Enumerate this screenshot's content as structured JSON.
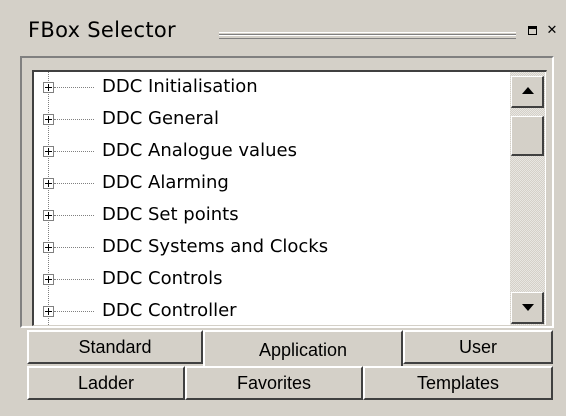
{
  "window": {
    "title": "FBox Selector"
  },
  "tree": {
    "items": [
      {
        "label": "DDC Initialisation"
      },
      {
        "label": "DDC General"
      },
      {
        "label": "DDC Analogue values"
      },
      {
        "label": "DDC Alarming"
      },
      {
        "label": "DDC Set points"
      },
      {
        "label": "DDC Systems and Clocks"
      },
      {
        "label": "DDC Controls"
      },
      {
        "label": "DDC Controller"
      }
    ]
  },
  "tabs": {
    "row1": [
      {
        "label": "Standard",
        "active": false
      },
      {
        "label": "Application",
        "active": true
      },
      {
        "label": "User",
        "active": false
      }
    ],
    "row2": [
      {
        "label": "Ladder",
        "active": false
      },
      {
        "label": "Favorites",
        "active": false
      },
      {
        "label": "Templates",
        "active": false
      }
    ]
  },
  "icons": {
    "maximize": "maximize-icon",
    "close": "close-icon",
    "expand": "plus-box-icon",
    "scroll_up": "triangle-up-icon",
    "scroll_down": "triangle-down-icon"
  },
  "colors": {
    "face": "#d4d0c8",
    "tree_bg": "#ffffff"
  }
}
